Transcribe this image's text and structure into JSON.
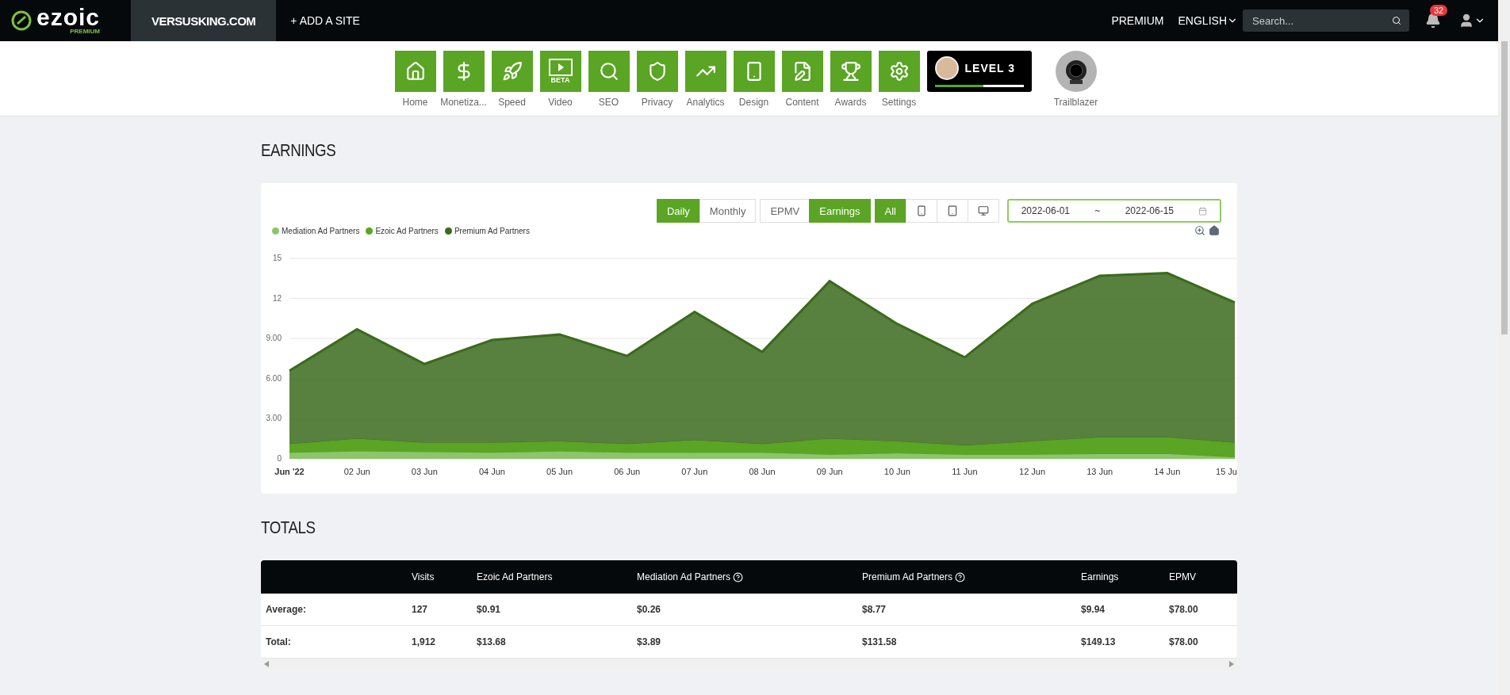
{
  "topbar": {
    "logo": "ezoic",
    "logo_sub": "PREMIUM",
    "site": "VERSUSKING.COM",
    "add_site": "+ ADD A SITE",
    "premium": "PREMIUM",
    "language": "ENGLISH",
    "search": {
      "placeholder": "Search..."
    },
    "notifications": "32"
  },
  "nav": [
    {
      "label": "Home",
      "kind": "home"
    },
    {
      "label": "Monetiza...",
      "kind": "dollar"
    },
    {
      "label": "Speed",
      "kind": "rocket"
    },
    {
      "label": "Video",
      "kind": "video",
      "badge": "BETA"
    },
    {
      "label": "SEO",
      "kind": "search"
    },
    {
      "label": "Privacy",
      "kind": "shield"
    },
    {
      "label": "Analytics",
      "kind": "chart"
    },
    {
      "label": "Design",
      "kind": "phone"
    },
    {
      "label": "Content",
      "kind": "document"
    },
    {
      "label": "Awards",
      "kind": "trophy"
    },
    {
      "label": "Settings",
      "kind": "gear"
    }
  ],
  "level": {
    "label": "LEVEL 3",
    "level": 0.55
  },
  "achievement": {
    "label": "Trailblazer"
  },
  "earnings": {
    "title": "EARNINGS",
    "period_tabs": [
      {
        "label": "Daily",
        "selected": true
      },
      {
        "label": "Monthly",
        "selected": false
      }
    ],
    "metric_tabs": [
      {
        "label": "EPMV",
        "selected": false
      },
      {
        "label": "Earnings",
        "selected": true
      }
    ],
    "device_tabs": [
      {
        "kind": "all",
        "label": "All",
        "selected": true
      },
      {
        "kind": "phone",
        "selected": false
      },
      {
        "kind": "tablet",
        "selected": false
      },
      {
        "kind": "desktop",
        "selected": false
      }
    ],
    "date_range": {
      "start": "2022-06-01",
      "separator": "~",
      "end": "2022-06-15"
    },
    "chart_data": {
      "type": "area",
      "stacked": true,
      "grid": true,
      "categories": [
        "Jun '22",
        "02 Jun",
        "03 Jun",
        "04 Jun",
        "05 Jun",
        "06 Jun",
        "07 Jun",
        "08 Jun",
        "09 Jun",
        "10 Jun",
        "11 Jun",
        "12 Jun",
        "13 Jun",
        "14 Jun",
        "15 Ju"
      ],
      "series": [
        {
          "name": "Mediation Ad Partners",
          "color": "#8cc56c",
          "values": [
            0.45,
            0.55,
            0.5,
            0.45,
            0.55,
            0.45,
            0.45,
            0.45,
            0.3,
            0.4,
            0.3,
            0.3,
            0.35,
            0.35,
            0.1
          ]
        },
        {
          "name": "Ezoic Ad Partners",
          "color": "#5aa524",
          "values": [
            0.65,
            0.95,
            0.7,
            0.75,
            0.75,
            0.65,
            0.95,
            0.65,
            1.2,
            0.9,
            0.7,
            1.0,
            1.25,
            1.25,
            1.1
          ]
        },
        {
          "name": "Premium Ad Partners",
          "color": "#3b6a1c",
          "values": [
            5.5,
            8.2,
            5.9,
            7.7,
            8.0,
            6.6,
            9.6,
            6.9,
            11.8,
            8.8,
            6.6,
            10.3,
            12.1,
            12.3,
            10.5
          ]
        }
      ],
      "ylim": [
        0,
        15
      ],
      "yticks": [
        0,
        {
          "value": 3,
          "label": "3.00"
        },
        {
          "value": 6,
          "label": "6.00"
        },
        {
          "value": 9,
          "label": "9.00"
        },
        12,
        15
      ]
    }
  },
  "totals": {
    "title": "TOTALS",
    "columns": [
      {
        "label": "Visits",
        "help": false
      },
      {
        "label": "Ezoic Ad Partners",
        "help": false
      },
      {
        "label": "Mediation Ad Partners",
        "help": true
      },
      {
        "label": "Premium Ad Partners",
        "help": true
      },
      {
        "label": "Earnings",
        "help": false
      },
      {
        "label": "EPMV",
        "help": false
      }
    ],
    "rows": [
      {
        "label": "Average:",
        "cells": [
          "127",
          "$0.91",
          "$0.26",
          "$8.77",
          "$9.94",
          "$78.00"
        ]
      },
      {
        "label": "Total:",
        "cells": [
          "1,912",
          "$13.68",
          "$3.89",
          "$131.58",
          "$149.13",
          "$78.00"
        ]
      }
    ]
  }
}
